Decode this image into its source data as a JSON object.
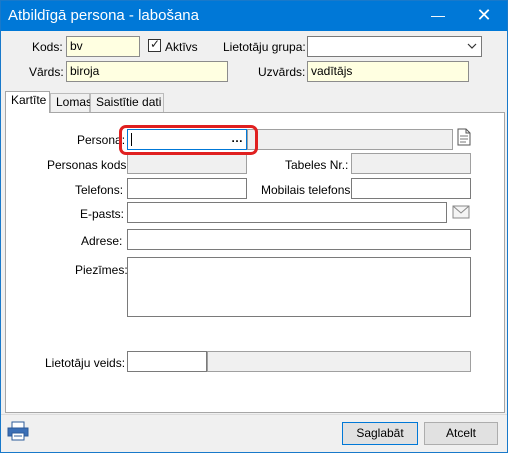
{
  "window": {
    "title": "Atbildīgā persona - labošana",
    "minimize_glyph": "—",
    "close_glyph": "✕"
  },
  "header": {
    "kods_label": "Kods:",
    "kods_value": "bv",
    "aktivs_label": "Aktīvs",
    "aktivs_checked": true,
    "grupa_label": "Lietotāju grupa:",
    "grupa_value": "",
    "vards_label": "Vārds:",
    "vards_value": "biroja",
    "uzvards_label": "Uzvārds:",
    "uzvards_value": "vadītājs"
  },
  "tabs": [
    {
      "label": "Kartīte",
      "active": true
    },
    {
      "label": "Lomas",
      "active": false
    },
    {
      "label": "Saistītie dati",
      "active": false
    }
  ],
  "card": {
    "persona_label": "Persona:",
    "persona_value": "",
    "persona_button": "…",
    "personas_kods_label": "Personas kods:",
    "tabeles_label": "Tabeles Nr.:",
    "telefons_label": "Telefons:",
    "mobilais_label": "Mobilais telefons:",
    "epasts_label": "E-pasts:",
    "adrese_label": "Adrese:",
    "piezimes_label": "Piezīmes:",
    "lietotaju_veids_label": "Lietotāju veids:"
  },
  "footer": {
    "save_label": "Saglabāt",
    "cancel_label": "Atcelt"
  },
  "colors": {
    "titlebar": "#0078d7",
    "required_field": "#ffffe1",
    "highlight": "#e02020"
  },
  "icons": {
    "print": "printer-icon",
    "persona_doc": "document-icon",
    "email": "envelope-icon",
    "dropdown": "chevron-down-icon"
  }
}
